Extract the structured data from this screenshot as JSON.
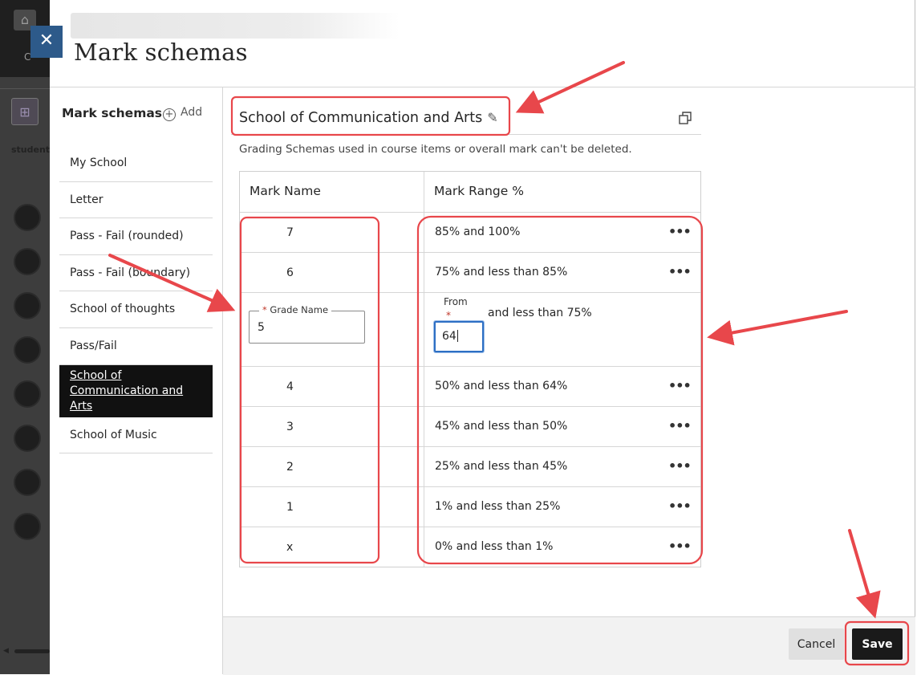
{
  "page_title": "Mark schemas",
  "close_label": "✕",
  "background": {
    "home_icon": "⌂",
    "c_text": "C",
    "grid_icon": "⊞",
    "students_text": "students"
  },
  "nav": {
    "heading": "Mark schemas",
    "add_label": "Add",
    "items": [
      {
        "label": "My School"
      },
      {
        "label": "Letter"
      },
      {
        "label": "Pass - Fail (rounded)"
      },
      {
        "label": "Pass - Fail (boundary)"
      },
      {
        "label": "School of thoughts"
      },
      {
        "label": "Pass/Fail"
      },
      {
        "label": "School of Communication and Arts"
      },
      {
        "label": "School of Music"
      }
    ]
  },
  "schema": {
    "title": "School of Communication and Arts",
    "note": "Grading Schemas used in course items or overall mark can't be deleted.",
    "col_name": "Mark Name",
    "col_range": "Mark Range %",
    "rows": [
      {
        "name": "7",
        "range": "85% and 100%"
      },
      {
        "name": "6",
        "range": "75% and less than 85%"
      },
      {
        "name": "5",
        "range_suffix": "and less than 75%",
        "from_value": "64",
        "editing": true
      },
      {
        "name": "4",
        "range": "50% and less than 64%"
      },
      {
        "name": "3",
        "range": "45% and less than 50%"
      },
      {
        "name": "2",
        "range": "25% and less than 45%"
      },
      {
        "name": "1",
        "range": "1% and less than 25%"
      },
      {
        "name": "x",
        "range": "0% and less than 1%"
      }
    ],
    "edit": {
      "grade_label": "Grade Name",
      "required_mark": "*",
      "from_label": "From"
    },
    "more_icon": "•••"
  },
  "footer": {
    "cancel_label": "Cancel",
    "save_label": "Save"
  },
  "colors": {
    "accent_blue": "#2d5a8a",
    "annotation_red": "#e8474b",
    "active_nav": "#111111"
  }
}
